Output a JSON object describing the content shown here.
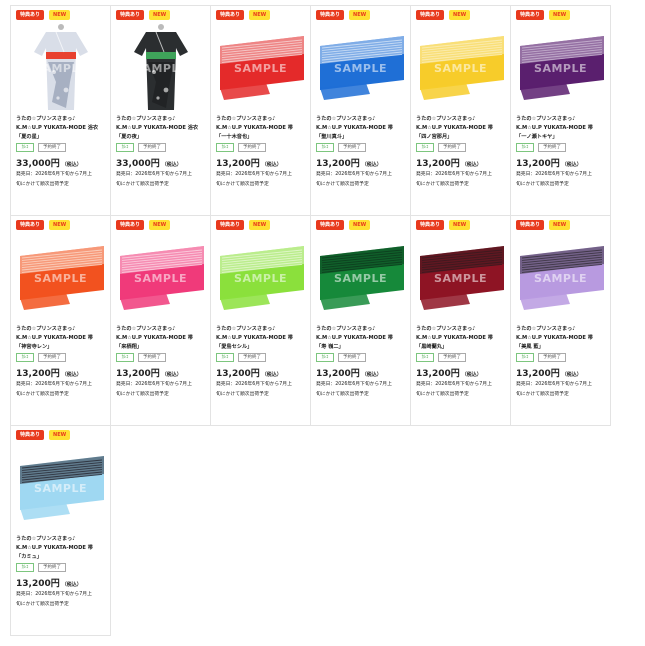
{
  "products": [
    {
      "image": "yukata",
      "colors": [
        "#d9dee8",
        "#7d8aa3"
      ],
      "obi": "#e8412f",
      "watermark": "SAMPLE",
      "perk": "特典あり",
      "new": "NEW",
      "series": "うたの☆プリンスさまっ♪",
      "line": "K.M☆U.P YUKATA-MODE 浴衣",
      "name": "「夏の星」",
      "tag1": "ｶﾚｺ",
      "tag2": "予約終了",
      "price": "33,000円",
      "tax": "（税込）",
      "release1": "発売日：2026年6月下旬から7月上",
      "release2": "旬にかけて順次出荷予定"
    },
    {
      "image": "yukata",
      "colors": [
        "#2b2e30",
        "#1a1c1d"
      ],
      "obi": "#3fa35a",
      "watermark": "SAMPLE",
      "perk": "特典あり",
      "new": "NEW",
      "series": "うたの☆プリンスさまっ♪",
      "line": "K.M☆U.P YUKATA-MODE 浴衣",
      "name": "「夏の夜」",
      "tag1": "ｶﾚｺ",
      "tag2": "予約終了",
      "price": "33,000円",
      "tax": "（税込）",
      "release1": "発売日：2026年6月下旬から7月上",
      "release2": "旬にかけて順次出荷予定"
    },
    {
      "image": "obi",
      "colors": [
        "#e42a2a",
        "#f6d0d0"
      ],
      "watermark": "SAMPLE",
      "perk": "特典あり",
      "new": "NEW",
      "series": "うたの☆プリンスさまっ♪",
      "line": "K.M☆U.P YUKATA-MODE 帯",
      "name": "「一十木音也」",
      "tag1": "ｶﾚｺ",
      "tag2": "予約終了",
      "price": "13,200円",
      "tax": "（税込）",
      "release1": "発売日：2026年6月下旬から7月上",
      "release2": "旬にかけて順次出荷予定"
    },
    {
      "image": "obi",
      "colors": [
        "#1f6fd6",
        "#cfe0f6"
      ],
      "watermark": "SAMPLE",
      "perk": "特典あり",
      "new": "NEW",
      "series": "うたの☆プリンスさまっ♪",
      "line": "K.M☆U.P YUKATA-MODE 帯",
      "name": "「聖川真斗」",
      "tag1": "ｶﾚｺ",
      "tag2": "予約終了",
      "price": "13,200円",
      "tax": "（税込）",
      "release1": "発売日：2026年6月下旬から7月上",
      "release2": "旬にかけて順次出荷予定"
    },
    {
      "image": "obi",
      "colors": [
        "#f7cc2a",
        "#fbeeb8"
      ],
      "watermark": "SAMPLE",
      "perk": "特典あり",
      "new": "NEW",
      "series": "うたの☆プリンスさまっ♪",
      "line": "K.M☆U.P YUKATA-MODE 帯",
      "name": "「四ノ宮那月」",
      "tag1": "ｶﾚｺ",
      "tag2": "予約終了",
      "price": "13,200円",
      "tax": "（税込）",
      "release1": "発売日：2026年6月下旬から7月上",
      "release2": "旬にかけて順次出荷予定"
    },
    {
      "image": "obi",
      "colors": [
        "#5a1f6e",
        "#c6b2d0"
      ],
      "watermark": "SAMPLE",
      "perk": "特典あり",
      "new": "NEW",
      "series": "うたの☆プリンスさまっ♪",
      "line": "K.M☆U.P YUKATA-MODE 帯",
      "name": "「一ノ瀬トキヤ」",
      "tag1": "ｶﾚｺ",
      "tag2": "予約終了",
      "price": "13,200円",
      "tax": "（税込）",
      "release1": "発売日：2026年6月下旬から7月上",
      "release2": "旬にかけて順次出荷予定"
    },
    {
      "image": "obi",
      "colors": [
        "#f2521f",
        "#fbd3c2"
      ],
      "watermark": "SAMPLE",
      "perk": "特典あり",
      "new": "NEW",
      "series": "うたの☆プリンスさまっ♪",
      "line": "K.M☆U.P YUKATA-MODE 帯",
      "name": "「神宮寺レン」",
      "tag1": "ｶﾚｺ",
      "tag2": "予約終了",
      "price": "13,200円",
      "tax": "（税込）",
      "release1": "発売日：2026年6月下旬から7月上",
      "release2": "旬にかけて順次出荷予定"
    },
    {
      "image": "obi",
      "colors": [
        "#f03a7a",
        "#fbd0e0"
      ],
      "watermark": "SAMPLE",
      "perk": "特典あり",
      "new": "NEW",
      "series": "うたの☆プリンスさまっ♪",
      "line": "K.M☆U.P YUKATA-MODE 帯",
      "name": "「来栖翔」",
      "tag1": "ｶﾚｺ",
      "tag2": "予約終了",
      "price": "13,200円",
      "tax": "（税込）",
      "release1": "発売日：2026年6月下旬から7月上",
      "release2": "旬にかけて順次出荷予定"
    },
    {
      "image": "obi",
      "colors": [
        "#8be03c",
        "#e3f7cf"
      ],
      "watermark": "SAMPLE",
      "perk": "特典あり",
      "new": "NEW",
      "series": "うたの☆プリンスさまっ♪",
      "line": "K.M☆U.P YUKATA-MODE 帯",
      "name": "「愛島セシル」",
      "tag1": "ｶﾚｺ",
      "tag2": "予約終了",
      "price": "13,200円",
      "tax": "（税込）",
      "release1": "発売日：2026年6月下旬から7月上",
      "release2": "旬にかけて順次出荷予定"
    },
    {
      "image": "obi",
      "colors": [
        "#16893a",
        "#0d3d1e"
      ],
      "watermark": "SAMPLE",
      "perk": "特典あり",
      "new": "NEW",
      "series": "うたの☆プリンスさまっ♪",
      "line": "K.M☆U.P YUKATA-MODE 帯",
      "name": "「寿 嶺二」",
      "tag1": "ｶﾚｺ",
      "tag2": "予約終了",
      "price": "13,200円",
      "tax": "（税込）",
      "release1": "発売日：2026年6月下旬から7月上",
      "release2": "旬にかけて順次出荷予定"
    },
    {
      "image": "obi",
      "colors": [
        "#8e1424",
        "#3a1a1f"
      ],
      "watermark": "SAMPLE",
      "perk": "特典あり",
      "new": "NEW",
      "series": "うたの☆プリンスさまっ♪",
      "line": "K.M☆U.P YUKATA-MODE 帯",
      "name": "「黒崎蘭丸」",
      "tag1": "ｶﾚｺ",
      "tag2": "予約終了",
      "price": "13,200円",
      "tax": "（税込）",
      "release1": "発売日：2026年6月下旬から7月上",
      "release2": "旬にかけて順次出荷予定"
    },
    {
      "image": "obi",
      "colors": [
        "#b89ae0",
        "#3a3340"
      ],
      "watermark": "SAMPLE",
      "perk": "特典あり",
      "new": "NEW",
      "series": "うたの☆プリンスさまっ♪",
      "line": "K.M☆U.P YUKATA-MODE 帯",
      "name": "「美風 藍」",
      "tag1": "ｶﾚｺ",
      "tag2": "予約終了",
      "price": "13,200円",
      "tax": "（税込）",
      "release1": "発売日：2026年6月下旬から7月上",
      "release2": "旬にかけて順次出荷予定"
    },
    {
      "image": "obi",
      "colors": [
        "#9fd8f2",
        "#2b2f3a"
      ],
      "watermark": "SAMPLE",
      "perk": "特典あり",
      "new": "NEW",
      "series": "うたの☆プリンスさまっ♪",
      "line": "K.M☆U.P YUKATA-MODE 帯",
      "name": "「カミュ」",
      "tag1": "ｶﾚｺ",
      "tag2": "予約終了",
      "price": "13,200円",
      "tax": "（税込）",
      "release1": "発売日：2026年6月下旬から7月上",
      "release2": "旬にかけて順次出荷予定"
    }
  ]
}
